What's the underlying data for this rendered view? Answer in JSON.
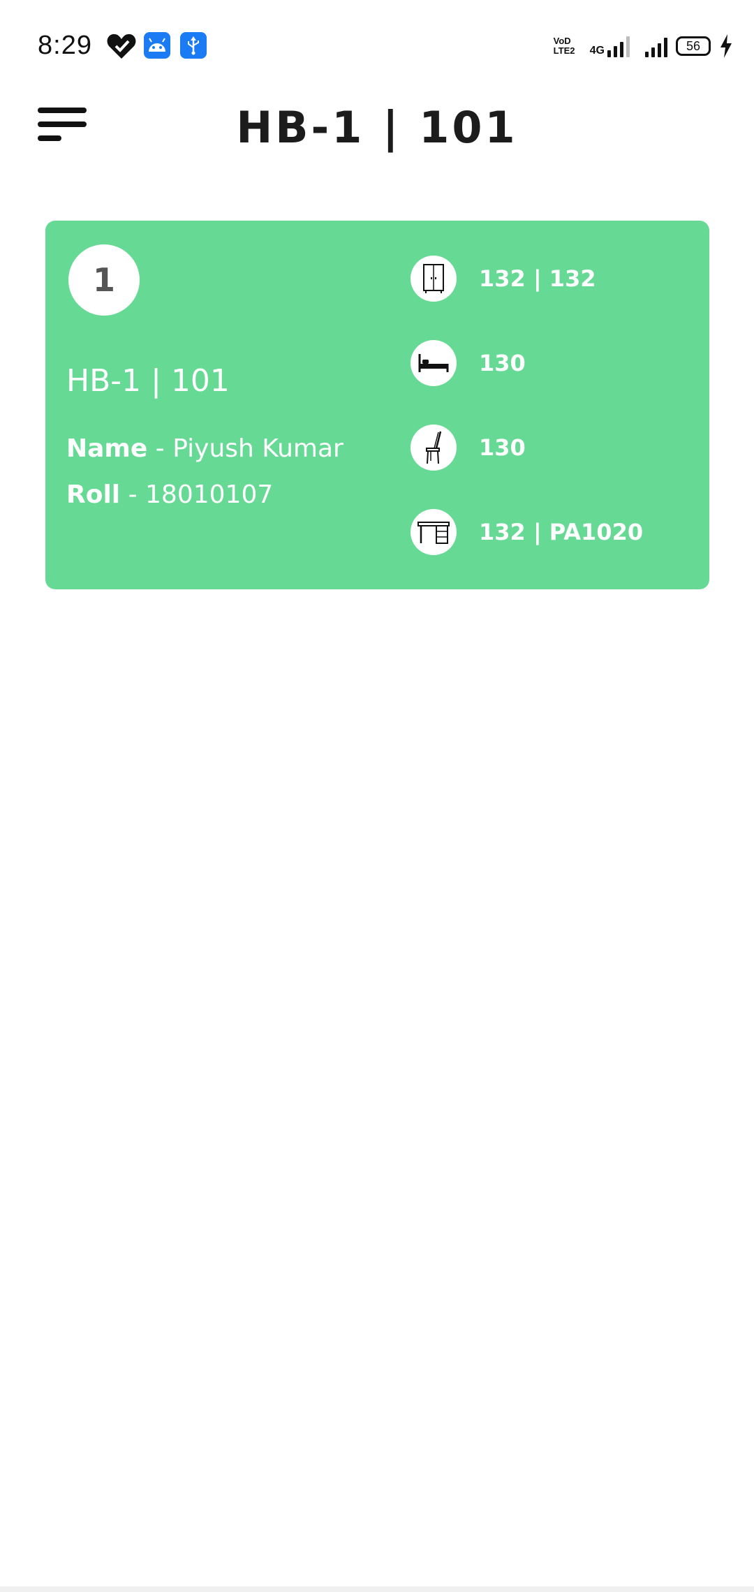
{
  "status_bar": {
    "time": "8:29",
    "icons": [
      "health-heart-icon",
      "android-icon",
      "usb-icon",
      "volte-icon",
      "signal-4g-icon",
      "signal-icon",
      "battery-icon",
      "charging-bolt-icon"
    ],
    "volte_top": "VoD",
    "volte_bottom": "LTE2",
    "network": "4G",
    "battery": "56"
  },
  "header": {
    "menu_icon": "menu-icon",
    "title": "HB-1 | 101"
  },
  "room_card": {
    "index": "1",
    "room_label": "HB-1 | 101",
    "name_label": "Name",
    "name_value": " - Piyush Kumar",
    "roll_label": "Roll",
    "roll_value": " - 18010107",
    "background": "#66d995",
    "assets": [
      {
        "icon": "wardrobe-icon",
        "value": "132 | 132"
      },
      {
        "icon": "bed-icon",
        "value": "130"
      },
      {
        "icon": "chair-icon",
        "value": "130"
      },
      {
        "icon": "desk-icon",
        "value": "132 | PA1020"
      }
    ]
  }
}
